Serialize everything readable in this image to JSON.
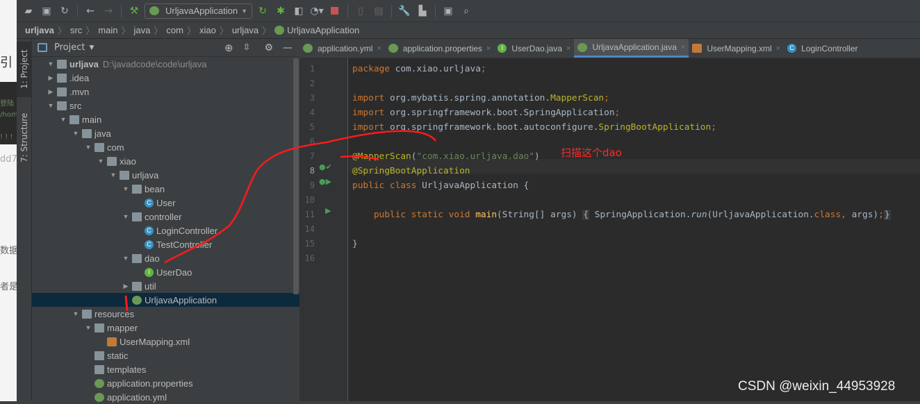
{
  "background_window": {
    "fragments": [
      "引",
      "登陆",
      "/home",
      "! ! !",
      "dd7",
      "数据",
      "者是"
    ]
  },
  "toolbar": {
    "run_config": "UrljavaApplication",
    "icons": [
      "open-icon",
      "save-icon",
      "sync-icon",
      "back-icon",
      "forward-icon",
      "build-icon",
      "rerun-icon",
      "debug-icon",
      "coverage-icon",
      "profile-icon",
      "stop-icon",
      "device-icon",
      "sdk-icon",
      "wrench-icon",
      "project-structure-icon",
      "terminal-icon",
      "search-icon"
    ]
  },
  "breadcrumb": [
    "urljava",
    "src",
    "main",
    "java",
    "com",
    "xiao",
    "urljava",
    "UrljavaApplication"
  ],
  "tool_strip": {
    "project": "1: Project",
    "structure": "7: Structure"
  },
  "project_panel": {
    "title": "Project",
    "tree": [
      {
        "label": "urljava",
        "path": "D:\\javadcode\\code\\urljava",
        "depth": 0,
        "type": "module",
        "expanded": true
      },
      {
        "label": ".idea",
        "depth": 0,
        "type": "folder",
        "expanded": false
      },
      {
        "label": ".mvn",
        "depth": 0,
        "type": "folder",
        "expanded": false
      },
      {
        "label": "src",
        "depth": 0,
        "type": "folder",
        "expanded": true
      },
      {
        "label": "main",
        "depth": 1,
        "type": "folder",
        "expanded": true
      },
      {
        "label": "java",
        "depth": 2,
        "type": "folder",
        "expanded": true
      },
      {
        "label": "com",
        "depth": 3,
        "type": "folder",
        "expanded": true
      },
      {
        "label": "xiao",
        "depth": 4,
        "type": "folder",
        "expanded": true
      },
      {
        "label": "urljava",
        "depth": 5,
        "type": "folder",
        "expanded": true
      },
      {
        "label": "bean",
        "depth": 6,
        "type": "folder",
        "expanded": true
      },
      {
        "label": "User",
        "depth": 7,
        "type": "class"
      },
      {
        "label": "controller",
        "depth": 6,
        "type": "folder",
        "expanded": true
      },
      {
        "label": "LoginController",
        "depth": 7,
        "type": "class"
      },
      {
        "label": "TestController",
        "depth": 7,
        "type": "class"
      },
      {
        "label": "dao",
        "depth": 6,
        "type": "folder",
        "expanded": true
      },
      {
        "label": "UserDao",
        "depth": 7,
        "type": "interface"
      },
      {
        "label": "util",
        "depth": 6,
        "type": "folder",
        "expanded": false
      },
      {
        "label": "UrljavaApplication",
        "depth": 6,
        "type": "spring",
        "selected": true
      },
      {
        "label": "resources",
        "depth": 2,
        "type": "folder",
        "expanded": true
      },
      {
        "label": "mapper",
        "depth": 3,
        "type": "folder",
        "expanded": true
      },
      {
        "label": "UserMapping.xml",
        "depth": 4,
        "type": "xml"
      },
      {
        "label": "static",
        "depth": 3,
        "type": "folder"
      },
      {
        "label": "templates",
        "depth": 3,
        "type": "folder"
      },
      {
        "label": "application.properties",
        "depth": 3,
        "type": "spring"
      },
      {
        "label": "application.yml",
        "depth": 3,
        "type": "spring"
      }
    ]
  },
  "editor": {
    "tabs": [
      {
        "label": "application.yml",
        "type": "spring"
      },
      {
        "label": "application.properties",
        "type": "spring"
      },
      {
        "label": "UserDao.java",
        "type": "interface"
      },
      {
        "label": "UrljavaApplication.java",
        "type": "spring",
        "active": true
      },
      {
        "label": "UserMapping.xml",
        "type": "xml"
      },
      {
        "label": "LoginController",
        "type": "class"
      }
    ],
    "line_numbers": [
      "1",
      "2",
      "3",
      "4",
      "5",
      "6",
      "7",
      "8",
      "9",
      "10",
      "11",
      "14",
      "15",
      "16"
    ],
    "lines": [
      [
        [
          "kw",
          "package "
        ],
        [
          "",
          "com.xiao.urljava"
        ],
        [
          "kw",
          ";"
        ]
      ],
      [],
      [
        [
          "kw",
          "import "
        ],
        [
          "",
          "org.mybatis.spring.annotation."
        ],
        [
          "an",
          "MapperScan"
        ],
        [
          "kw",
          ";"
        ]
      ],
      [
        [
          "kw",
          "import "
        ],
        [
          "",
          "org.springframework.boot.SpringApplication"
        ],
        [
          "kw",
          ";"
        ]
      ],
      [
        [
          "kw",
          "import "
        ],
        [
          "",
          "org.springframework.boot.autoconfigure."
        ],
        [
          "an",
          "SpringBootApplication"
        ],
        [
          "kw",
          ";"
        ]
      ],
      [],
      [
        [
          "an",
          "@MapperScan"
        ],
        [
          "",
          "("
        ],
        [
          "st",
          "\"com.xiao.urljava.dao\""
        ],
        [
          "",
          ")"
        ]
      ],
      [
        [
          "an",
          "@SpringBootApplication"
        ]
      ],
      [
        [
          "kw",
          "public class "
        ],
        [
          "",
          "UrljavaApplication {"
        ]
      ],
      [],
      [
        [
          "kw",
          "    public static void "
        ],
        [
          "an2",
          "main"
        ],
        [
          "",
          "(String[] args) "
        ],
        [
          "fold",
          "{"
        ],
        [
          "",
          " SpringApplication."
        ],
        [
          "it",
          "run"
        ],
        [
          "",
          "(UrljavaApplication."
        ],
        [
          "kw",
          "class, "
        ],
        [
          "",
          "args)"
        ],
        [
          "kw",
          ";"
        ],
        [
          "fold",
          "}"
        ]
      ],
      [],
      [
        [
          "",
          "}"
        ]
      ],
      []
    ],
    "annotation_note": "扫描这个dao"
  },
  "watermark": "CSDN @weixin_44953928",
  "colors": {
    "annotation_red": "#ff2a2a",
    "selection": "#0d293e",
    "keyword": "#cc7832",
    "string": "#6a8759",
    "annotation": "#bbb529"
  }
}
